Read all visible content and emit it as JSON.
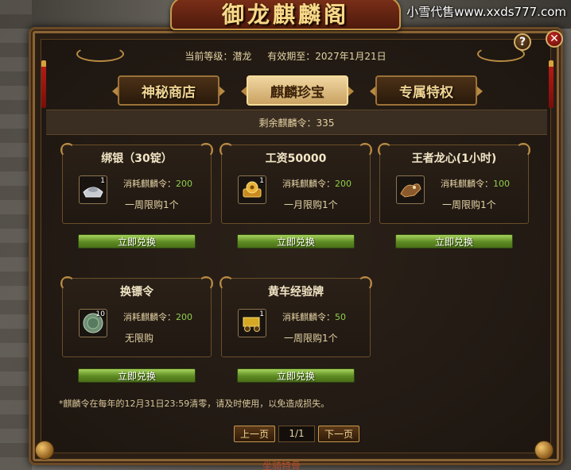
{
  "watermark": "小雪代售www.xxds777.com",
  "window": {
    "title": "御龙麒麟阁"
  },
  "status": {
    "level_label": "当前等级：潜龙",
    "expiry_label": "有效期至：2027年1月21日"
  },
  "tabs": [
    {
      "label": "神秘商店",
      "active": false
    },
    {
      "label": "麒麟珍宝",
      "active": true
    },
    {
      "label": "专属特权",
      "active": false
    }
  ],
  "points": {
    "label": "剩余麒麟令：335"
  },
  "items": [
    {
      "title": "绑银（30锭）",
      "icon": "silver-ingot-icon",
      "count": "1",
      "cost_label": "消耗麒麟令：",
      "cost": "200",
      "limit": "一周限购1个",
      "button": "立即兑换"
    },
    {
      "title": "工资50000",
      "icon": "gold-coin-pouch-icon",
      "count": "1",
      "cost_label": "消耗麒麟令：",
      "cost": "200",
      "limit": "一月限购1个",
      "button": "立即兑换"
    },
    {
      "title": "王者龙心(1小时)",
      "icon": "dragon-heart-icon",
      "count": "",
      "cost_label": "消耗麒麟令：",
      "cost": "100",
      "limit": "一周限购1个",
      "button": "立即兑换"
    },
    {
      "title": "换镖令",
      "icon": "escort-token-icon",
      "count": "10",
      "cost_label": "消耗麒麟令：",
      "cost": "200",
      "limit": "无限购",
      "button": "立即兑换"
    },
    {
      "title": "黄车经验牌",
      "icon": "yellow-cart-icon",
      "count": "1",
      "cost_label": "消耗麒麟令：",
      "cost": "50",
      "limit": "一周限购1个",
      "button": "立即兑换"
    }
  ],
  "footnote": "*麒麟令在每年的12月31日23:59清零，请及时使用，以免造成损失。",
  "pager": {
    "prev": "上一页",
    "page": "1/1",
    "next": "下一页"
  },
  "bottom_label": "坐骑特骨",
  "colors": {
    "accent_gold": "#f0d493",
    "cost_green": "#8fd04a",
    "button_green": "#5d8a22",
    "frame_brown": "#6b4a26"
  }
}
